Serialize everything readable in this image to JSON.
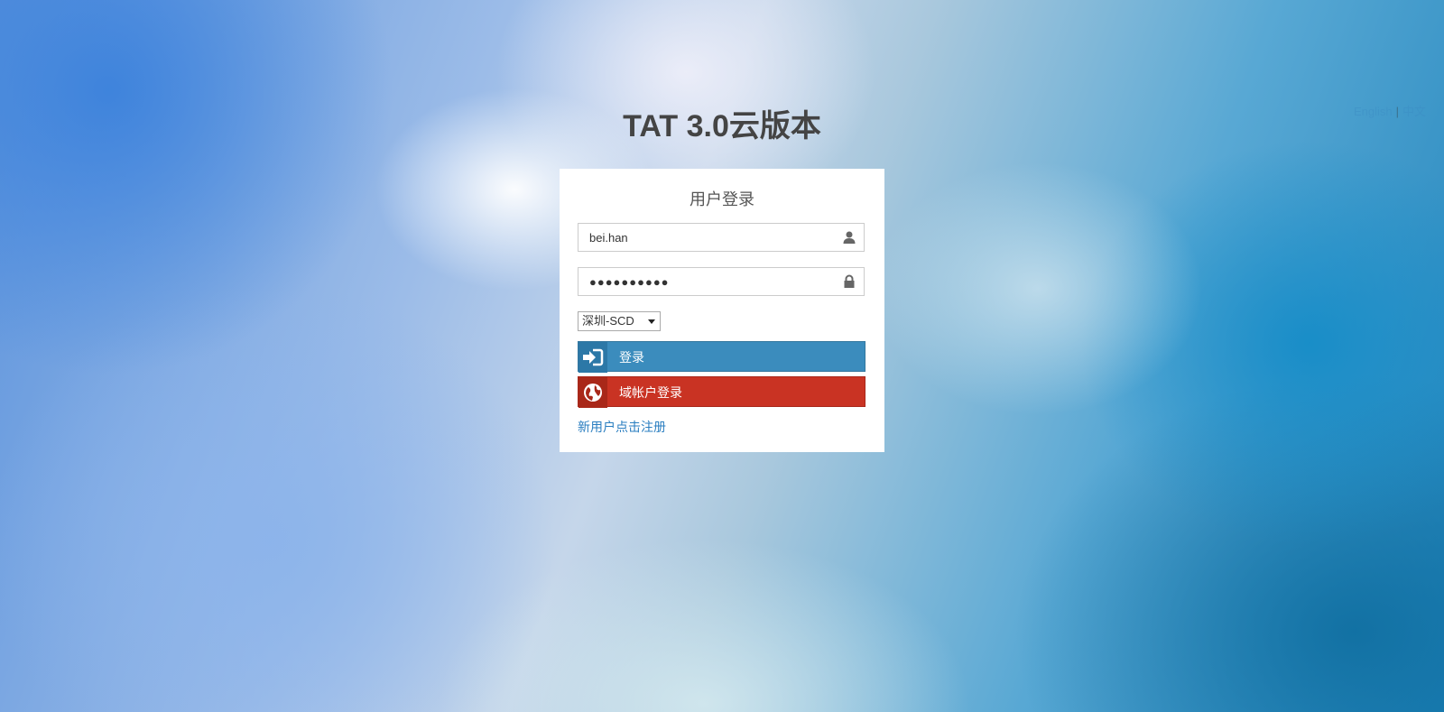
{
  "language_switch": {
    "english": "English",
    "separator": "|",
    "chinese": "中文"
  },
  "page_title": "TAT 3.0云版本",
  "login_card": {
    "title": "用户登录",
    "username": {
      "value": "bei.han",
      "icon": "user-icon"
    },
    "password": {
      "value": "●●●●●●●●●●",
      "icon": "lock-icon"
    },
    "region_select": {
      "selected": "深圳-SCD"
    },
    "login_button": {
      "label": "登录",
      "icon": "sign-in-icon"
    },
    "domain_login_button": {
      "label": "域帐户登录",
      "icon": "globe-icon"
    },
    "register_link": "新用户点击注册"
  },
  "colors": {
    "login_button": "#3b8cbd",
    "domain_button": "#c93323",
    "link": "#2a7ec0"
  }
}
